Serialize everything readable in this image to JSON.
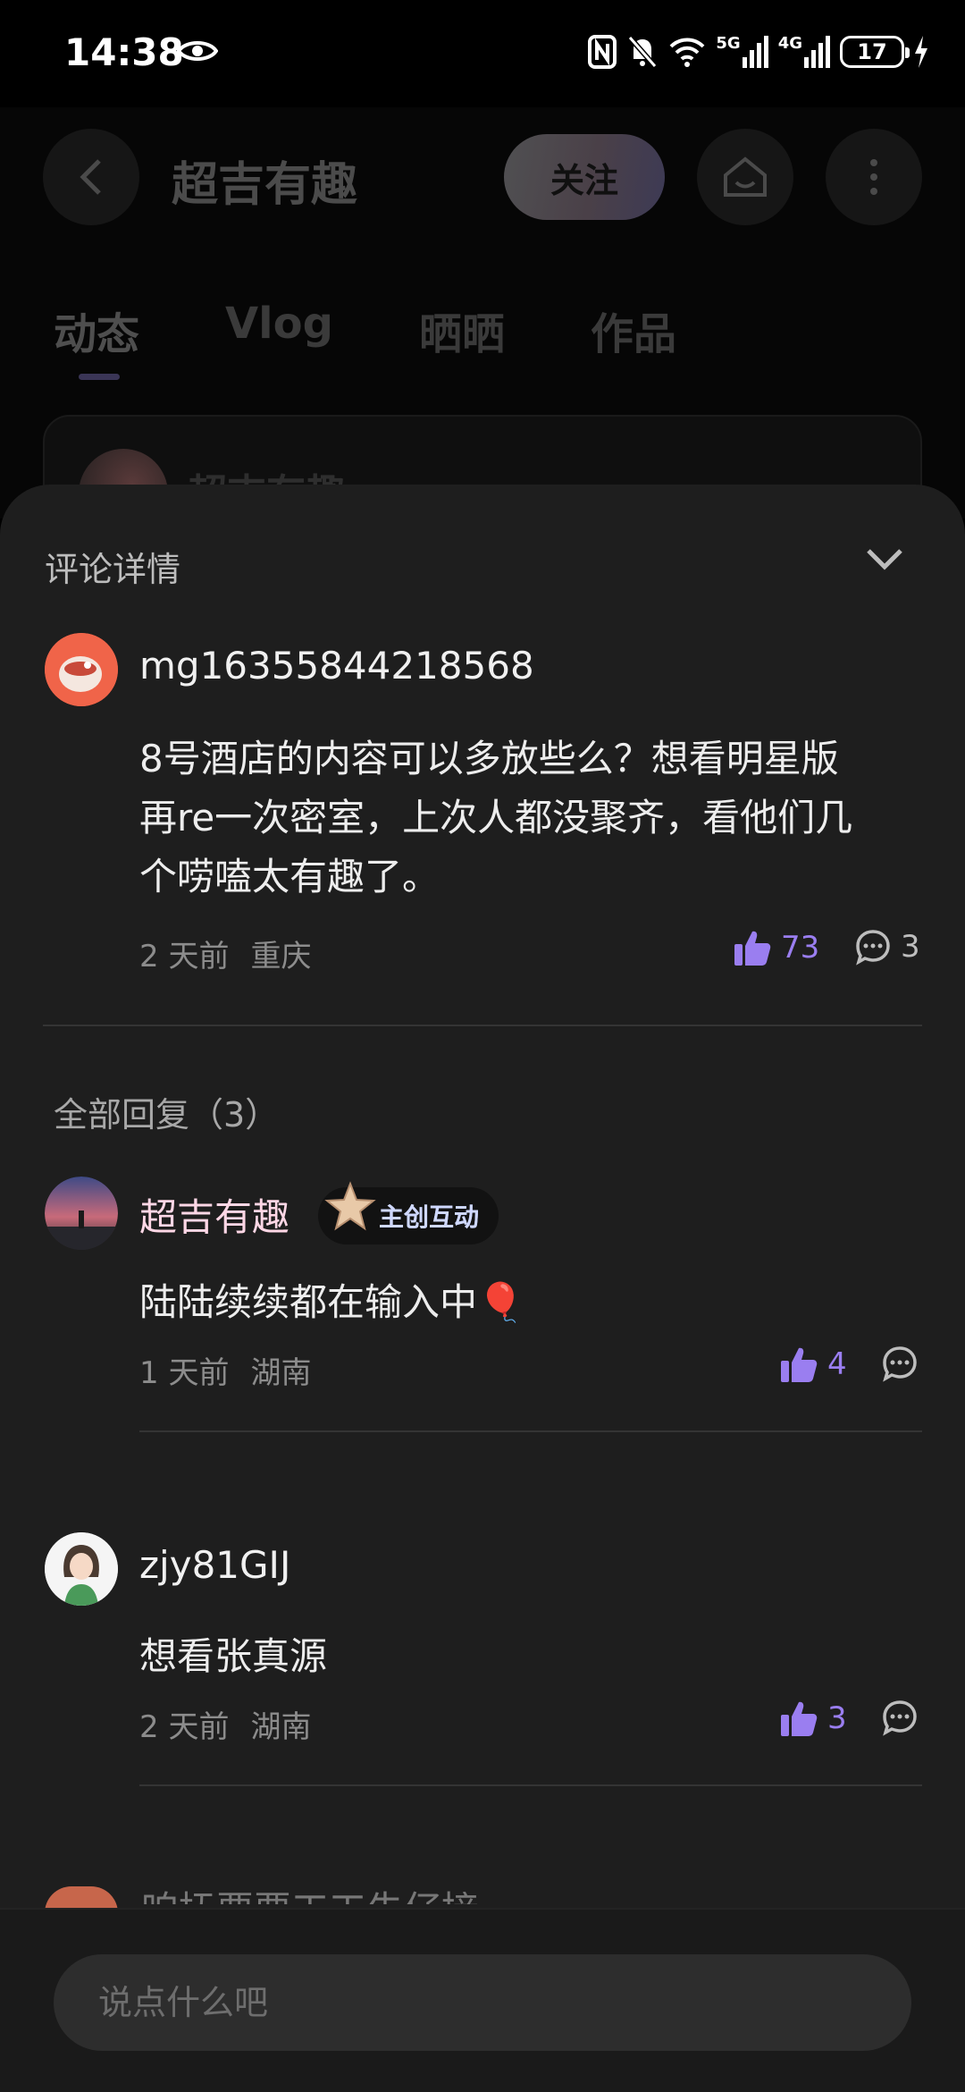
{
  "status_bar": {
    "time": "14:38",
    "network_5g": "5G",
    "network_4g": "4G",
    "battery": "17"
  },
  "header": {
    "title": "超吉有趣",
    "follow_label": "关注"
  },
  "tabs": [
    {
      "label": "动态",
      "active": true
    },
    {
      "label": "Vlog",
      "active": false
    },
    {
      "label": "晒晒",
      "active": false
    },
    {
      "label": "作品",
      "active": false
    }
  ],
  "background_card": {
    "name": "超吉有趣"
  },
  "sheet": {
    "title": "评论详情",
    "main_comment": {
      "username": "mg16355844218568",
      "text_lines": [
        "8号酒店的内容可以多放些么？想看明星版",
        "再re一次密室，上次人都没聚齐，看他们几",
        "个唠嗑太有趣了。"
      ],
      "time": "2 天前",
      "location": "重庆",
      "likes": "73",
      "replies": "3"
    },
    "replies_title": "全部回复（3）",
    "replies": [
      {
        "username": "超吉有趣",
        "badge": "主创互动",
        "text": "陆陆续续都在输入中🎈",
        "time": "1 天前",
        "location": "湖南",
        "likes": "4"
      },
      {
        "username": "zjy81GIJ",
        "text": "想看张真源",
        "time": "2 天前",
        "location": "湖南",
        "likes": "3"
      }
    ],
    "peek_text": "咱抚要要工工朱仔接"
  },
  "input": {
    "placeholder": "说点什么吧"
  },
  "colors": {
    "like_accent": "#9a7ef0",
    "sheet_bg": "#1e1e1e"
  }
}
